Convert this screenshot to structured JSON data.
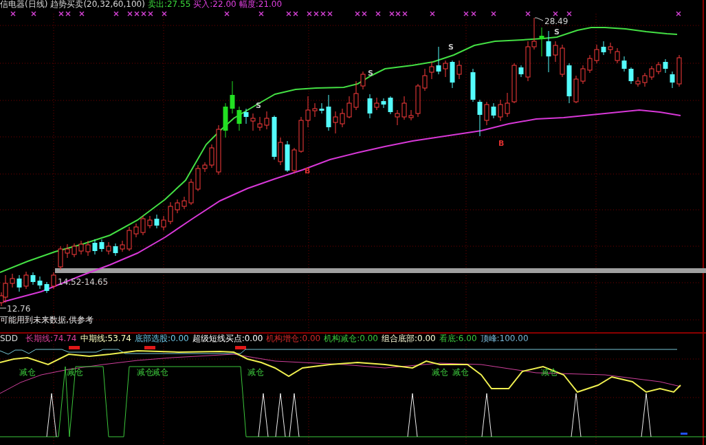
{
  "main_chart": {
    "title": "信电器(日线)",
    "indicators": [
      {
        "text": "趋势买卖(20,32,60,100)",
        "color": "#d8d8d8"
      },
      {
        "text": "卖出:27.55",
        "color": "#3cdc3c"
      },
      {
        "text": "买入:22.00",
        "color": "#e040e0"
      },
      {
        "text": "幅度:21.00",
        "color": "#e040e0"
      }
    ],
    "high_label": "28.49",
    "range_label": "14.52-14.65",
    "low_label": "12.76",
    "note": "可能用到未来数据,供参考",
    "signals": [
      {
        "kind": "sell",
        "text": "S"
      },
      {
        "kind": "buy",
        "text": "B"
      },
      {
        "kind": "sell",
        "text": "S"
      },
      {
        "kind": "sell",
        "text": "S"
      },
      {
        "kind": "buy",
        "text": "B"
      },
      {
        "kind": "sell",
        "text": "S"
      }
    ]
  },
  "indicator_panel": {
    "name": "SDD",
    "legend": [
      {
        "text": "长期线:74.74",
        "color": "#e0409c"
      },
      {
        "text": "中期线:53.74",
        "color": "#ffffc0"
      },
      {
        "text": "底部选股:0.00",
        "color": "#70c8e8"
      },
      {
        "text": "超级短线买点:0.00",
        "color": "#ffffff"
      },
      {
        "text": "机构增仓:0.00",
        "color": "#d02828"
      },
      {
        "text": "机构减仓:0.00",
        "color": "#3cc83c"
      },
      {
        "text": "组合底部:0.00",
        "color": "#ffffd8"
      },
      {
        "text": "看底:6.00",
        "color": "#3cc83c"
      },
      {
        "text": "顶峰:100.00",
        "color": "#78b8d8"
      }
    ],
    "markers": [
      "减仓",
      "减仓",
      "减仓",
      "减仓",
      "减仓",
      "减仓",
      "减仓",
      "减仓"
    ]
  }
}
